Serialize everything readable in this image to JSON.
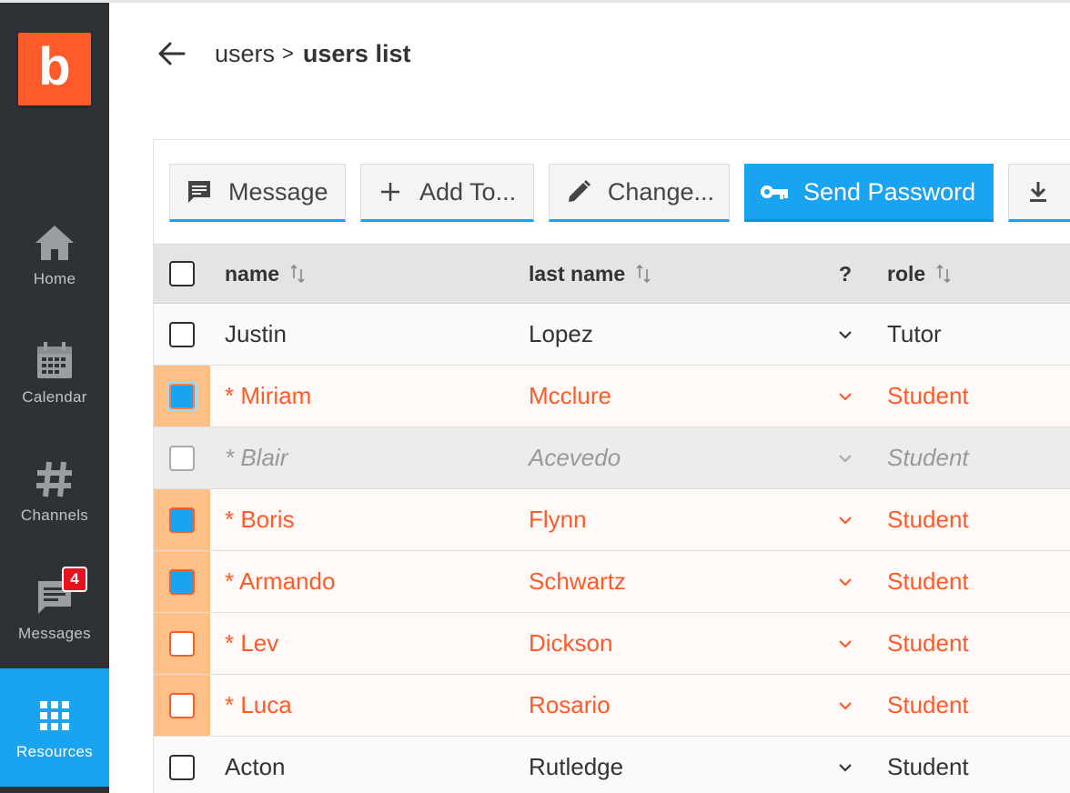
{
  "colors": {
    "accent": "#1aa3f0",
    "brand": "#ff5a2a",
    "sidebar": "#2f3235",
    "selected_row_marker": "#ffc087",
    "badge": "#e8111e"
  },
  "logo": {
    "letter": "b"
  },
  "sidebar": {
    "items": [
      {
        "label": "Home",
        "icon": "home-icon",
        "active": false
      },
      {
        "label": "Calendar",
        "icon": "calendar-icon",
        "active": false
      },
      {
        "label": "Channels",
        "icon": "hash-icon",
        "active": false
      },
      {
        "label": "Messages",
        "icon": "message-icon",
        "active": false,
        "badge": "4"
      },
      {
        "label": "Resources",
        "icon": "grid-icon",
        "active": true
      }
    ]
  },
  "header": {
    "breadcrumb_parent": "users",
    "breadcrumb_separator": ">",
    "breadcrumb_current": "users list"
  },
  "toolbar": {
    "buttons": [
      {
        "label": "Message",
        "icon": "message-icon"
      },
      {
        "label": "Add To...",
        "icon": "plus-icon"
      },
      {
        "label": "Change...",
        "icon": "pencil-icon"
      },
      {
        "label": "Send Password",
        "icon": "key-icon",
        "primary": true
      },
      {
        "label": "",
        "icon": "download-icon"
      }
    ]
  },
  "table": {
    "columns": {
      "name": "name",
      "last_name": "last name",
      "q": "?",
      "role": "role"
    },
    "rows": [
      {
        "name": "Justin",
        "last_name": "Lopez",
        "role": "Tutor",
        "state": "normal",
        "checked": false
      },
      {
        "name": "* Miriam",
        "last_name": "Mcclure",
        "role": "Student",
        "state": "selected",
        "checked": true,
        "focused": true
      },
      {
        "name": "* Blair",
        "last_name": "Acevedo",
        "role": "Student",
        "state": "dim",
        "checked": false
      },
      {
        "name": "* Boris",
        "last_name": "Flynn",
        "role": "Student",
        "state": "selected",
        "checked": true
      },
      {
        "name": "* Armando",
        "last_name": "Schwartz",
        "role": "Student",
        "state": "selected",
        "checked": true
      },
      {
        "name": "* Lev",
        "last_name": "Dickson",
        "role": "Student",
        "state": "selected",
        "checked": false
      },
      {
        "name": "* Luca",
        "last_name": "Rosario",
        "role": "Student",
        "state": "selected",
        "checked": false
      },
      {
        "name": "Acton",
        "last_name": "Rutledge",
        "role": "Student",
        "state": "normal",
        "checked": false
      }
    ]
  }
}
